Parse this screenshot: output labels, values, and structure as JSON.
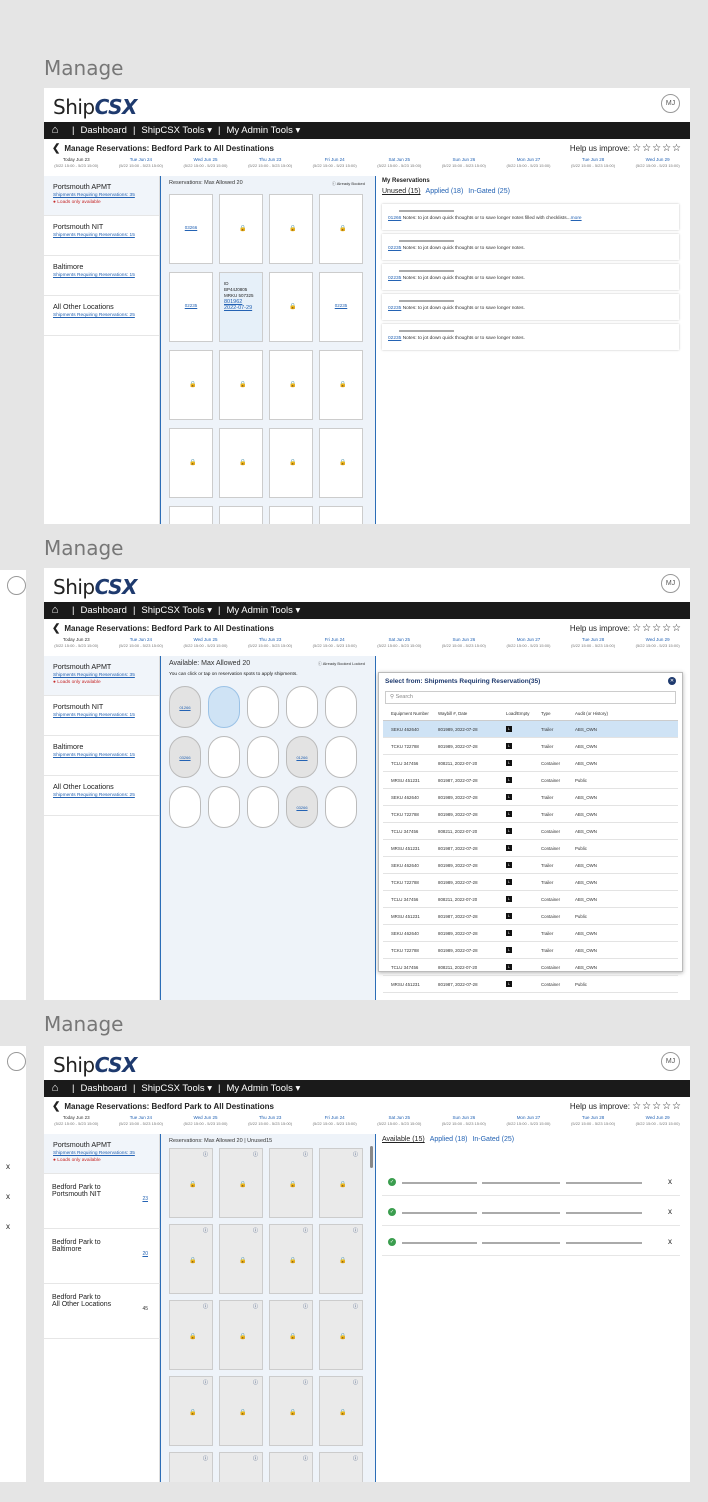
{
  "section_title": "Manage",
  "app": {
    "logo_a": "Ship",
    "logo_b": "CSX",
    "avatar": "MJ",
    "nav": {
      "dashboard": "Dashboard",
      "tools": "ShipCSX Tools ▾",
      "admin": "My Admin Tools ▾"
    },
    "page_title": "Manage Reservations: Bedford Park to All Destinations",
    "help": "Help us improve:",
    "stars": "☆☆☆☆☆"
  },
  "dates": [
    {
      "d": "Today Jun 23",
      "r": "(5/22 15:00 - 5/23 15:00)"
    },
    {
      "d": "Tue Jun 24",
      "r": "(5/22 15:00 - 5/23 15:00)"
    },
    {
      "d": "Wed Jun 25",
      "r": "(5/22 15:00 - 5/23 15:00)"
    },
    {
      "d": "Thu Jun 23",
      "r": "(5/22 15:00 - 5/23 15:00)"
    },
    {
      "d": "Fri Jun 24",
      "r": "(5/22 15:00 - 5/23 15:00)"
    },
    {
      "d": "Sat Jun 25",
      "r": "(5/22 15:00 - 5/23 15:00)"
    },
    {
      "d": "Sun Jun 26",
      "r": "(5/22 15:00 - 5/23 15:00)"
    },
    {
      "d": "Mon Jun 27",
      "r": "(5/22 15:00 - 5/23 15:00)"
    },
    {
      "d": "Tue Jun 28",
      "r": "(5/22 15:00 - 5/23 15:00)"
    },
    {
      "d": "Wed Jun 29",
      "r": "(5/22 15:00 - 5/23 15:00)"
    }
  ],
  "locations": [
    {
      "name": "Portsmouth APMT",
      "link": "Shipments Requiring Reservations: 35",
      "note": "● Loads only available"
    },
    {
      "name": "Portsmouth NIT",
      "link": "Shipments Requiring Reservations: 15"
    },
    {
      "name": "Baltimore",
      "link": "Shipments Requiring Reservations: 15"
    },
    {
      "name": "All Other Locations",
      "link": "Shipments Requiring Reservations: 25"
    }
  ],
  "panel1": {
    "grid_head": "Reservations: Max Allowed 20",
    "booked": "ⓘ Already Booked",
    "res_code": "01266",
    "res_code2": "02235",
    "res_code3": "03266",
    "detail": {
      "id": "ID",
      "a": "BP44J0805",
      "b": "MRKU 507325",
      "c": "801962",
      "d": "2022-07-29"
    },
    "my_res": "My Reservations",
    "tabs": [
      "Unused (15)",
      "Applied (18)",
      "In-Gated (25)"
    ],
    "notes": [
      {
        "code": "01266",
        "text": "Notes: to jot down quick thoughts or to save longer notes filled with checklists...",
        "more": "more"
      },
      {
        "code": "02235",
        "text": "Notes: to jot down quick thoughts or to save longer notes."
      },
      {
        "code": "02235",
        "text": "Notes: to jot down quick thoughts or to save longer notes."
      },
      {
        "code": "02235",
        "text": "Notes: to jot down quick thoughts or to save longer notes."
      },
      {
        "code": "02235",
        "text": "Notes: to jot down quick thoughts or to save longer notes."
      }
    ]
  },
  "panel2": {
    "grid_head": "Available: Max Allowed 20",
    "booked": "ⓘ Already Booked Locked",
    "hint": "You can click or tap on reservation spots to apply shipments.",
    "modal_title": "Select from: Shipments Requiring Reservation(35)",
    "search_placeholder": "Search",
    "columns": [
      "Equipment Number",
      "Waybill #, Date",
      "Load/Empty",
      "Type",
      "Audit (or History)"
    ],
    "rows": [
      [
        "SEKU 462640",
        "801989, 2022-07-28",
        "L",
        "Trailer",
        "ABS_OWN"
      ],
      [
        "TCKU 722788",
        "801989, 2022-07-28",
        "L",
        "Trailer",
        "ABS_OWN"
      ],
      [
        "TCLU 347456",
        "808211, 2022-07-20",
        "L",
        "Container",
        "ABS_OWN"
      ],
      [
        "MRSU 451231",
        "801987, 2022-07-28",
        "L",
        "Container",
        "Public"
      ],
      [
        "SEKU 462640",
        "801989, 2022-07-28",
        "L",
        "Trailer",
        "ABS_OWN"
      ],
      [
        "TCKU 722788",
        "801989, 2022-07-28",
        "L",
        "Trailer",
        "ABS_OWN"
      ],
      [
        "TCLU 347456",
        "808211, 2022-07-20",
        "L",
        "Container",
        "ABS_OWN"
      ],
      [
        "MRSU 451231",
        "801987, 2022-07-28",
        "L",
        "Container",
        "Public"
      ],
      [
        "SEKU 462640",
        "801989, 2022-07-28",
        "L",
        "Trailer",
        "ABS_OWN"
      ],
      [
        "TCKU 722788",
        "801989, 2022-07-28",
        "L",
        "Trailer",
        "ABS_OWN"
      ],
      [
        "TCLU 347456",
        "808211, 2022-07-20",
        "L",
        "Container",
        "ABS_OWN"
      ],
      [
        "MRSU 451231",
        "801987, 2022-07-28",
        "L",
        "Container",
        "Public"
      ],
      [
        "SEKU 462640",
        "801989, 2022-07-28",
        "L",
        "Trailer",
        "ABS_OWN"
      ],
      [
        "TCKU 722788",
        "801989, 2022-07-28",
        "L",
        "Trailer",
        "ABS_OWN"
      ],
      [
        "TCLU 347456",
        "808211, 2022-07-20",
        "L",
        "Container",
        "ABS_OWN"
      ],
      [
        "MRSU 451231",
        "801987, 2022-07-28",
        "L",
        "Container",
        "Public"
      ]
    ]
  },
  "panel3": {
    "grid_head": "Reservations: Max Allowed 20 | Unused15",
    "routes": [
      {
        "a": "Bedford Park  to",
        "b": "Portsmouth NIT",
        "n": "23"
      },
      {
        "a": "Bedford Park  to",
        "b": "Baltimore",
        "n": "20"
      },
      {
        "a": "Bedford Park  to",
        "b": "All Other Locations",
        "n": "45"
      }
    ],
    "tabs": [
      "Available (15)",
      "Applied (18)",
      "In-Gated (25)"
    ],
    "close": "x"
  }
}
